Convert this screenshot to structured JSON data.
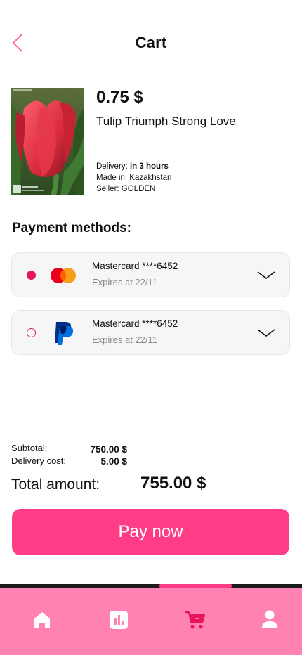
{
  "header": {
    "title": "Cart",
    "back_icon": "chevron-left-icon"
  },
  "product": {
    "price": "0.75 $",
    "name": "Tulip Triumph Strong Love",
    "delivery_label": "Delivery:",
    "delivery_value": "in 3 hours",
    "made_in": "Made in: Kazakhstan",
    "seller": "Seller: GOLDEN"
  },
  "payment": {
    "title": "Payment methods:",
    "methods": [
      {
        "name": "Mastercard ****6452",
        "expires": "Expires at 22/11",
        "selected": true,
        "logo": "mastercard-logo"
      },
      {
        "name": "Mastercard ****6452",
        "expires": "Expires at 22/11",
        "selected": false,
        "logo": "paypal-logo"
      }
    ]
  },
  "summary": {
    "subtotal_label": "Subtotal:",
    "subtotal_value": "750.00 $",
    "delivery_label": "Delivery cost:",
    "delivery_value": "5.00 $",
    "total_label": "Total amount:",
    "total_value": "755.00 $"
  },
  "actions": {
    "pay_label": "Pay now"
  },
  "nav": {
    "items": [
      "home-icon",
      "stats-icon",
      "cart-icon",
      "profile-icon"
    ],
    "active": "cart-icon"
  },
  "colors": {
    "accent": "#ff3d86",
    "nav_bg": "#ff82b3",
    "radio": "#e8155b"
  }
}
